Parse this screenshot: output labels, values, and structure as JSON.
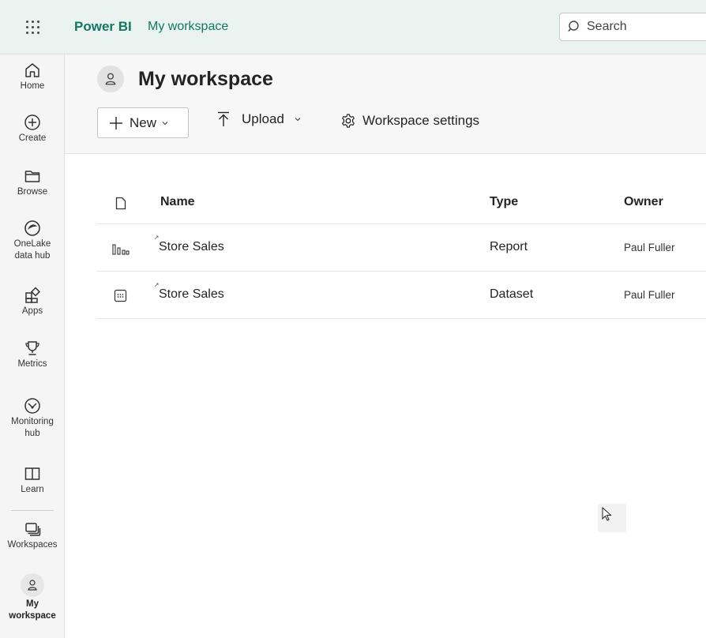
{
  "topbar": {
    "brand": "Power BI",
    "breadcrumb": "My workspace",
    "search_placeholder": "Search"
  },
  "nav": {
    "items": [
      {
        "label": "Home",
        "icon": "home-icon"
      },
      {
        "label": "Create",
        "icon": "plus-circle-icon"
      },
      {
        "label": "Browse",
        "icon": "folder-icon"
      },
      {
        "label": "OneLake\ndata hub",
        "icon": "onelake-icon"
      },
      {
        "label": "Apps",
        "icon": "apps-icon"
      },
      {
        "label": "Metrics",
        "icon": "trophy-icon"
      },
      {
        "label": "Monitoring\nhub",
        "icon": "monitoring-icon"
      },
      {
        "label": "Learn",
        "icon": "book-icon"
      },
      {
        "label": "Workspaces",
        "icon": "workspaces-icon"
      },
      {
        "label": "My\nworkspace",
        "icon": "user-icon"
      }
    ]
  },
  "header": {
    "title": "My workspace",
    "new_label": "New",
    "upload_label": "Upload",
    "settings_label": "Workspace settings"
  },
  "table": {
    "columns": [
      "Name",
      "Type",
      "Owner"
    ],
    "rows": [
      {
        "name": "Store Sales",
        "type": "Report",
        "owner": "Paul Fuller",
        "icon": "report-icon"
      },
      {
        "name": "Store Sales",
        "type": "Dataset",
        "owner": "Paul Fuller",
        "icon": "dataset-icon"
      }
    ]
  },
  "colors": {
    "brand": "#117865",
    "topbar_bg": "#ebf3f0",
    "nav_bg": "#f5f5f5"
  }
}
